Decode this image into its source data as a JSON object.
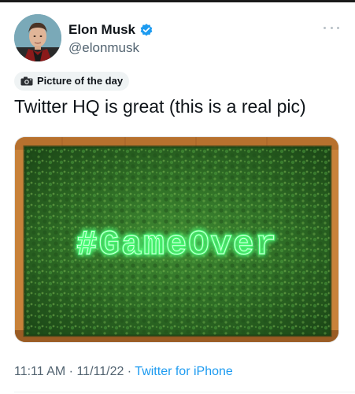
{
  "author": {
    "name": "Elon Musk",
    "handle": "@elonmusk",
    "verified_color": "#1d9bf0"
  },
  "label": {
    "icon": "camera-icon",
    "text": "Picture of the day"
  },
  "tweet": {
    "text": "Twitter HQ is great (this is a real pic)"
  },
  "photo": {
    "sign_text": "#GameOver",
    "sign_color": "#39ff6a",
    "wall_color": "#2f6b25",
    "frame_color": "#d08a3e"
  },
  "meta": {
    "time": "11:11 AM",
    "separator": " · ",
    "date": "11/11/22",
    "source": "Twitter for iPhone"
  },
  "colors": {
    "text": "#0f1419",
    "secondary": "#536471",
    "accent": "#1d9bf0"
  },
  "icons": {
    "more": "more-icon",
    "verified": "verified-icon"
  }
}
